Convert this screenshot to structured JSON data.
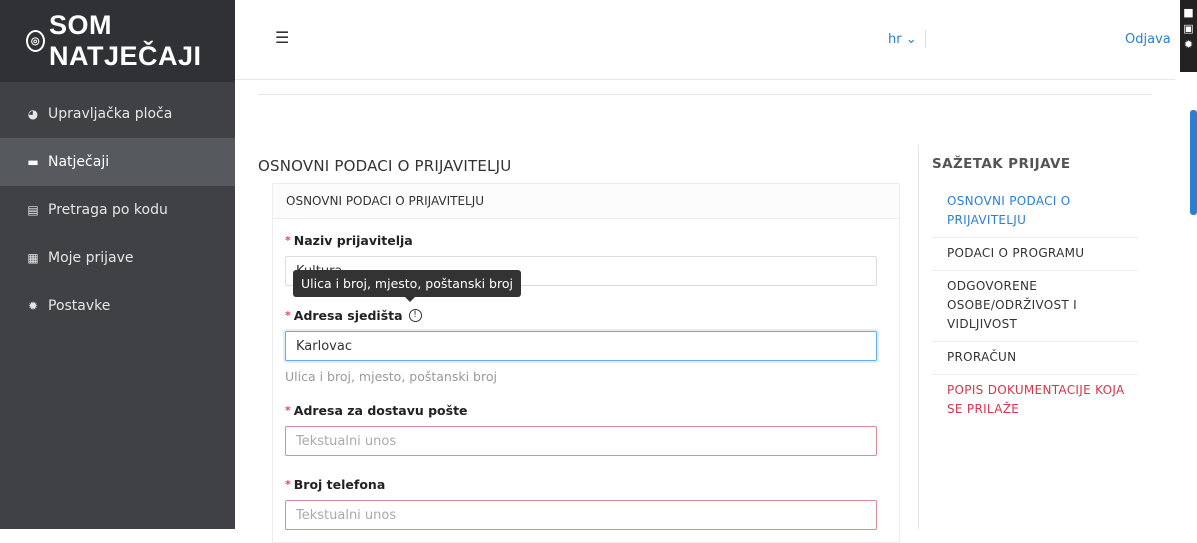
{
  "brand": {
    "logo_icon": "logo-circle-icon",
    "title": "SOM NATJEČAJI"
  },
  "sidebar": {
    "items": [
      {
        "label": "Upravljačka ploča",
        "icon": "pie-chart-icon",
        "active": false
      },
      {
        "label": "Natječaji",
        "icon": "folder-icon",
        "active": true
      },
      {
        "label": "Pretraga po kodu",
        "icon": "document-icon",
        "active": false
      },
      {
        "label": "Moje prijave",
        "icon": "file-icon",
        "active": false
      },
      {
        "label": "Postavke",
        "icon": "gear-icon",
        "active": false
      }
    ]
  },
  "topbar": {
    "lang": "hr ⌄",
    "logout": "Odjava"
  },
  "main": {
    "section_title": "OSNOVNI PODACI O PRIJAVITELJU",
    "card_title": "OSNOVNI PODACI O PRIJAVITELJU",
    "fields": {
      "naziv": {
        "label": "Naziv prijavitelja",
        "value": "Kultura"
      },
      "adresa": {
        "label": "Adresa sjedišta",
        "value": "Karlovac",
        "help": "Ulica i broj, mjesto, poštanski broj"
      },
      "dostava": {
        "label": "Adresa za dostavu pošte",
        "placeholder": "Tekstualni unos"
      },
      "telefon": {
        "label": "Broj telefona",
        "placeholder": "Tekstualni unos"
      }
    },
    "tooltip": "Ulica i broj, mjesto, poštanski broj"
  },
  "summary": {
    "title": "SAŽETAK PRIJAVE",
    "items": [
      {
        "label": "OSNOVNI PODACI O PRIJAVITELJU",
        "state": "current"
      },
      {
        "label": "PODACI O PROGRAMU",
        "state": "normal"
      },
      {
        "label": "ODGOVORENE OSOBE/ODRŽIVOST I VIDLJIVOST",
        "state": "normal"
      },
      {
        "label": "PRORAČUN",
        "state": "normal"
      },
      {
        "label": "POPIS DOKUMENTACIJE KOJA SE PRILAŽE",
        "state": "error"
      }
    ]
  },
  "colors": {
    "sidebar_bg": "#3f4144",
    "accent": "#2a7fd4",
    "error": "#d8344a"
  }
}
